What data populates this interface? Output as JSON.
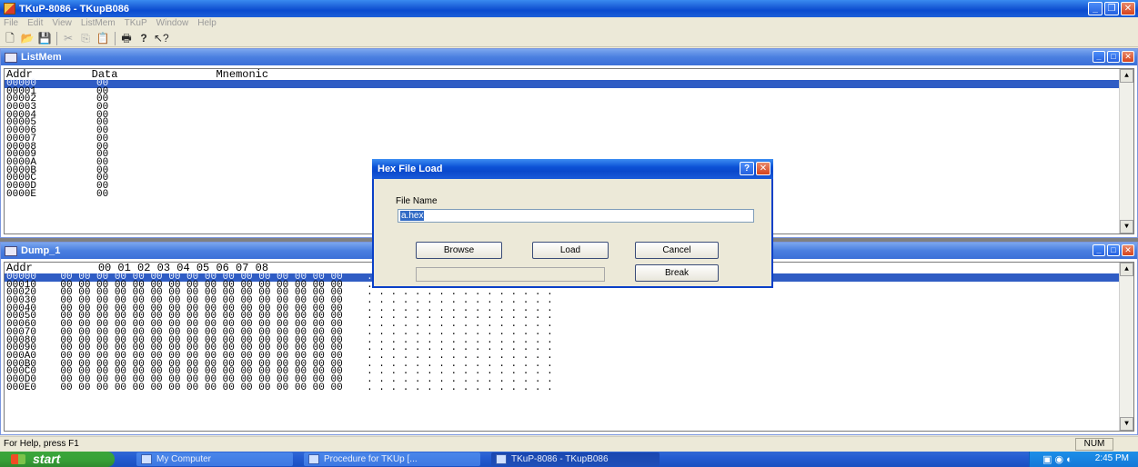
{
  "window": {
    "title": "TKuP-8086 - TKupB086"
  },
  "menu": [
    "File",
    "Edit",
    "View",
    "ListMem",
    "TKuP",
    "Window",
    "Help"
  ],
  "toolbar": {
    "icons": [
      "new-icon",
      "open-icon",
      "save-icon",
      "cut-icon",
      "copy-icon",
      "paste-icon",
      "print-icon",
      "about-icon",
      "help-pointer-icon"
    ]
  },
  "listmem": {
    "title": "ListMem",
    "header": {
      "addr": "Addr",
      "data": "Data",
      "mnemonic": "Mnemonic"
    },
    "rows": [
      {
        "addr": "00000",
        "data": "00"
      },
      {
        "addr": "00001",
        "data": "00"
      },
      {
        "addr": "00002",
        "data": "00"
      },
      {
        "addr": "00003",
        "data": "00"
      },
      {
        "addr": "00004",
        "data": "00"
      },
      {
        "addr": "00005",
        "data": "00"
      },
      {
        "addr": "00006",
        "data": "00"
      },
      {
        "addr": "00007",
        "data": "00"
      },
      {
        "addr": "00008",
        "data": "00"
      },
      {
        "addr": "00009",
        "data": "00"
      },
      {
        "addr": "0000A",
        "data": "00"
      },
      {
        "addr": "0000B",
        "data": "00"
      },
      {
        "addr": "0000C",
        "data": "00"
      },
      {
        "addr": "0000D",
        "data": "00"
      },
      {
        "addr": "0000E",
        "data": "00"
      }
    ]
  },
  "dump": {
    "title": "Dump_1",
    "header": {
      "addr": "Addr",
      "cols": "00 01 02 03 04 05 06 07 08"
    },
    "rows": [
      {
        "addr": "00000",
        "bytes": "00 00 00 00 00 00 00 00 00 00 00 00 00 00 00 00",
        "ascii": ". . . . . . . . . . . . . . . ."
      },
      {
        "addr": "00010",
        "bytes": "00 00 00 00 00 00 00 00 00 00 00 00 00 00 00 00",
        "ascii": ". . . . . . . . . . . . . . . ."
      },
      {
        "addr": "00020",
        "bytes": "00 00 00 00 00 00 00 00 00 00 00 00 00 00 00 00",
        "ascii": ". . . . . . . . . . . . . . . ."
      },
      {
        "addr": "00030",
        "bytes": "00 00 00 00 00 00 00 00 00 00 00 00 00 00 00 00",
        "ascii": ". . . . . . . . . . . . . . . ."
      },
      {
        "addr": "00040",
        "bytes": "00 00 00 00 00 00 00 00 00 00 00 00 00 00 00 00",
        "ascii": ". . . . . . . . . . . . . . . ."
      },
      {
        "addr": "00050",
        "bytes": "00 00 00 00 00 00 00 00 00 00 00 00 00 00 00 00",
        "ascii": ". . . . . . . . . . . . . . . ."
      },
      {
        "addr": "00060",
        "bytes": "00 00 00 00 00 00 00 00 00 00 00 00 00 00 00 00",
        "ascii": ". . . . . . . . . . . . . . . ."
      },
      {
        "addr": "00070",
        "bytes": "00 00 00 00 00 00 00 00 00 00 00 00 00 00 00 00",
        "ascii": ". . . . . . . . . . . . . . . ."
      },
      {
        "addr": "00080",
        "bytes": "00 00 00 00 00 00 00 00 00 00 00 00 00 00 00 00",
        "ascii": ". . . . . . . . . . . . . . . ."
      },
      {
        "addr": "00090",
        "bytes": "00 00 00 00 00 00 00 00 00 00 00 00 00 00 00 00",
        "ascii": ". . . . . . . . . . . . . . . ."
      },
      {
        "addr": "000A0",
        "bytes": "00 00 00 00 00 00 00 00 00 00 00 00 00 00 00 00",
        "ascii": ". . . . . . . . . . . . . . . ."
      },
      {
        "addr": "000B0",
        "bytes": "00 00 00 00 00 00 00 00 00 00 00 00 00 00 00 00",
        "ascii": ". . . . . . . . . . . . . . . ."
      },
      {
        "addr": "000C0",
        "bytes": "00 00 00 00 00 00 00 00 00 00 00 00 00 00 00 00",
        "ascii": ". . . . . . . . . . . . . . . ."
      },
      {
        "addr": "000D0",
        "bytes": "00 00 00 00 00 00 00 00 00 00 00 00 00 00 00 00",
        "ascii": ". . . . . . . . . . . . . . . ."
      },
      {
        "addr": "000E0",
        "bytes": "00 00 00 00 00 00 00 00 00 00 00 00 00 00 00 00",
        "ascii": ". . . . . . . . . . . . . . . ."
      }
    ]
  },
  "dialog": {
    "title": "Hex File Load",
    "file_label": "File Name",
    "file_value": "a.hex",
    "browse": "Browse",
    "load": "Load",
    "cancel": "Cancel",
    "break": "Break"
  },
  "status": {
    "help": "For Help, press F1",
    "num": "NUM"
  },
  "taskbar": {
    "start": "start",
    "tasks": [
      "My Computer",
      "Procedure for TKUp [...",
      "TKuP-8086 - TKupB086"
    ],
    "clock": "2:45 PM"
  },
  "colors": {
    "selection": "#2f5cc4",
    "title_blue": "#0a4bd0",
    "taskbar": "#245cd1",
    "start_green": "#37a237"
  }
}
